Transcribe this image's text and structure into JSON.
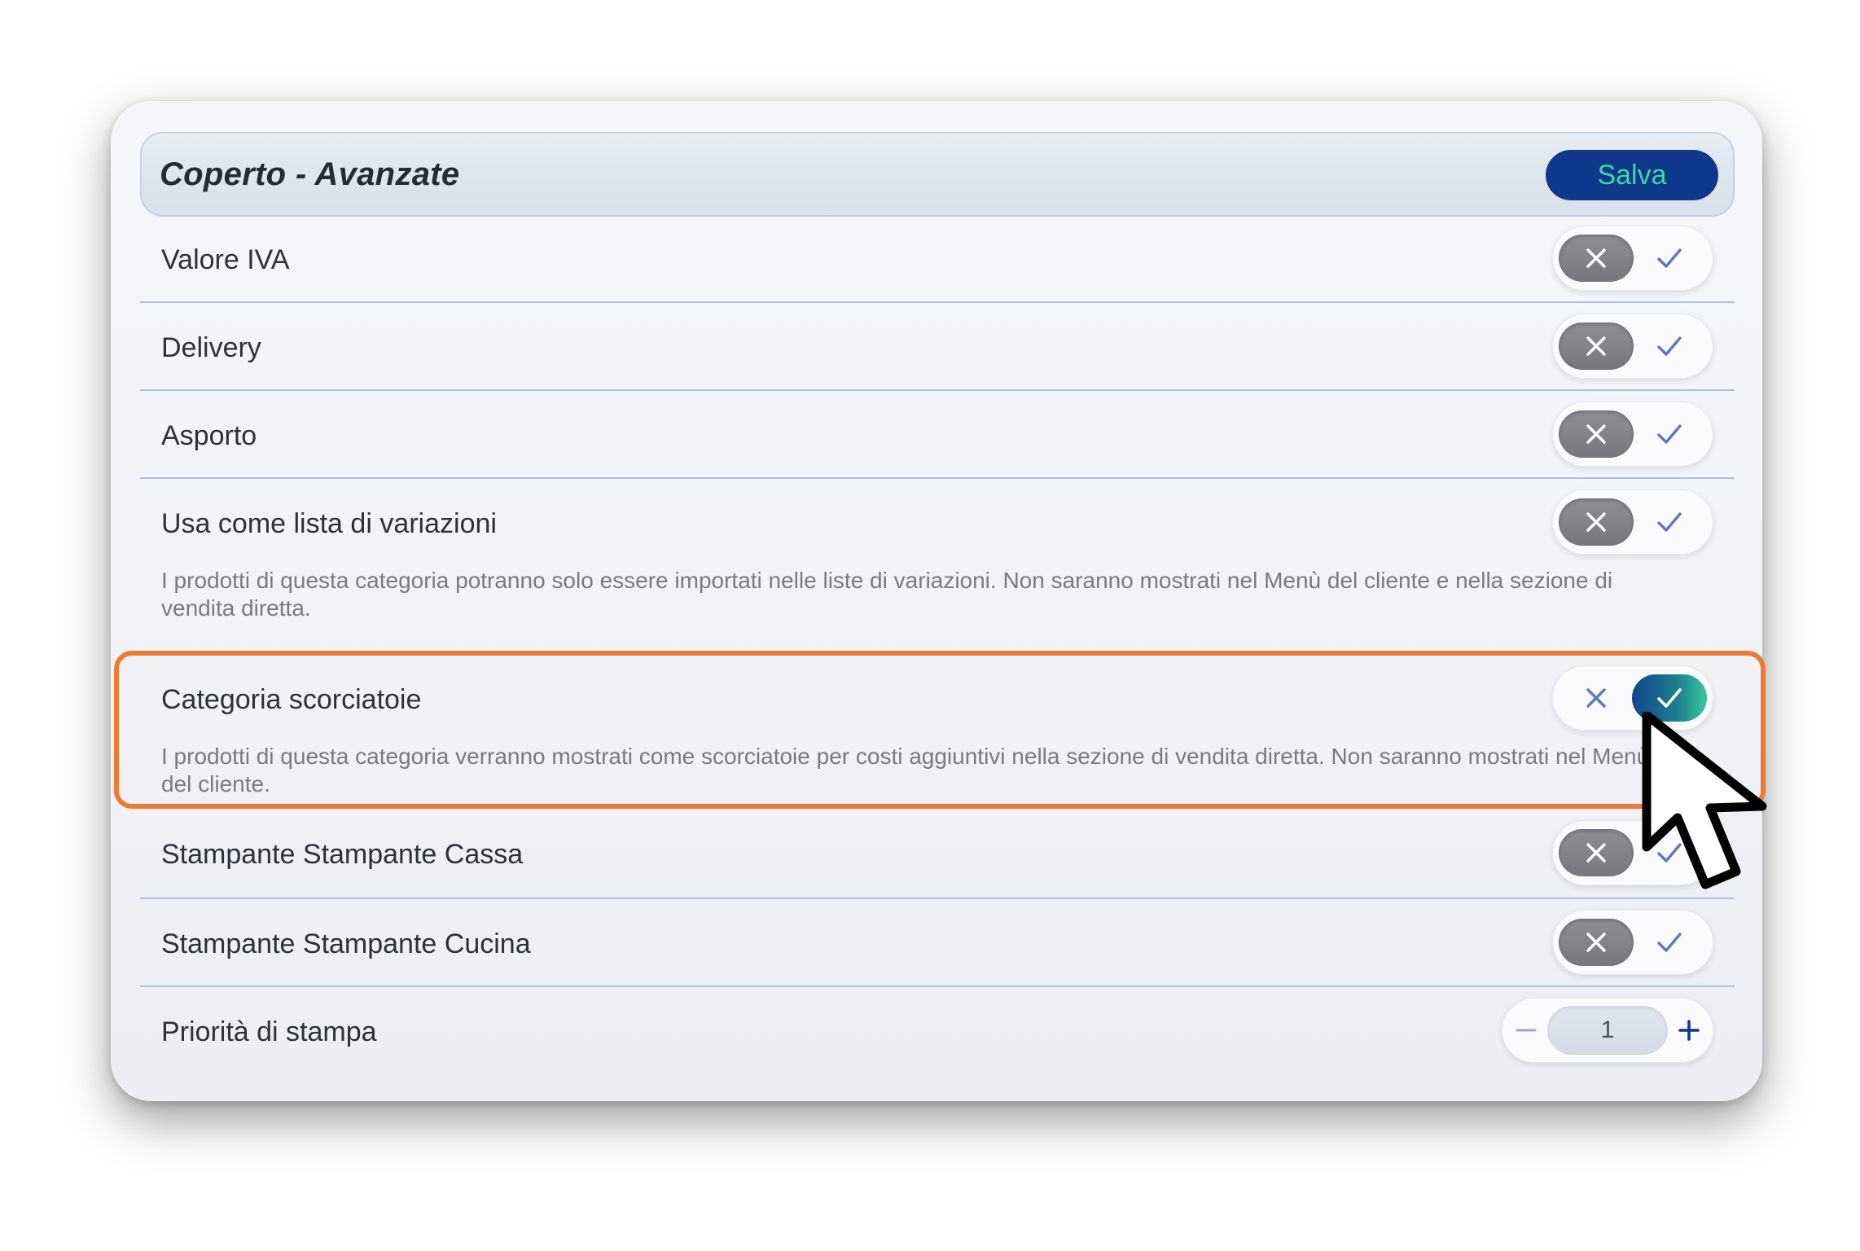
{
  "header": {
    "title": "Coperto - Avanzate",
    "save_label": "Salva"
  },
  "rows": [
    {
      "label": "Valore IVA",
      "state": "off"
    },
    {
      "label": "Delivery",
      "state": "off"
    },
    {
      "label": "Asporto",
      "state": "off"
    },
    {
      "label": "Usa come lista di variazioni",
      "state": "off",
      "description": "I prodotti di questa categoria potranno solo essere importati nelle liste di variazioni. Non saranno mostrati nel Menù del cliente e nella sezione di vendita diretta."
    },
    {
      "label": "Categoria scorciatoie",
      "state": "on",
      "description": "I prodotti di questa categoria verranno mostrati come scorciatoie per costi aggiuntivi nella sezione di vendita diretta. Non saranno mostrati nel Menù del cliente."
    },
    {
      "label": "Stampante Stampante Cassa",
      "state": "off"
    },
    {
      "label": "Stampante Stampante Cucina",
      "state": "off"
    }
  ],
  "priority": {
    "label": "Priorità di stampa",
    "value": "1",
    "minus_icon": "minus-icon",
    "plus_icon": "plus-icon"
  },
  "icons": {
    "off": "close-icon",
    "on": "check-icon",
    "pointer": "mouse-pointer-icon"
  },
  "colors": {
    "save_button_bg": "#10388a",
    "save_button_text": "#3fd6a6",
    "highlight_border": "#ee7a30",
    "toggle_off_bg": "#7f8287",
    "toggle_on_gradient_start": "#10468e",
    "toggle_on_gradient_end": "#35c89a",
    "divider": "#aebfd9"
  }
}
